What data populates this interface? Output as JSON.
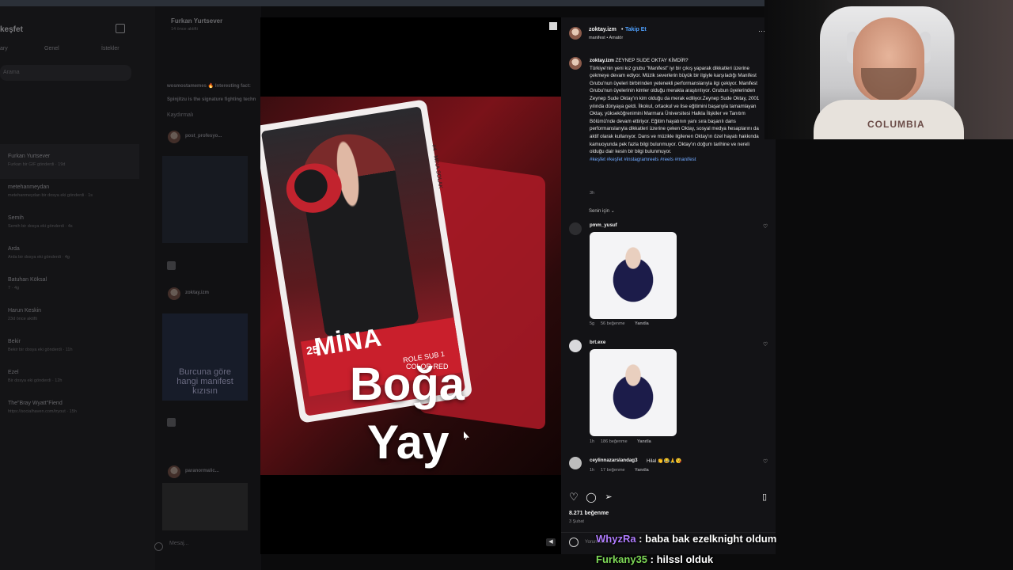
{
  "dm": {
    "title": "keşfet",
    "tabs": [
      "ary",
      "Genel",
      "İstekler"
    ],
    "search_placeholder": "Arama",
    "conversations": [
      {
        "name": "Furkan Yurtsever",
        "sub": "Furkan bir GIF gönderdi · 19d"
      },
      {
        "name": "metehanmeydan",
        "sub": "metehanmeydan bir dosya eki gönderdi · 1s"
      },
      {
        "name": "Semih",
        "sub": "Semih bir dosya eki gönderdi · 4s"
      },
      {
        "name": "Arda",
        "sub": "Arda bir dosya eki gönderdi · 4g"
      },
      {
        "name": "Batuhan Köksal",
        "sub": "7 · 4g"
      },
      {
        "name": "Harun Keskin",
        "sub": "23d önce aktifti"
      },
      {
        "name": "Bekir",
        "sub": "Bekir bir dosya eki gönderdi · 11h"
      },
      {
        "name": "Ezel",
        "sub": "Bir dosya eki gönderdi · 12h"
      },
      {
        "name": "The\"Bray Wyatt\"Fiend",
        "sub": "https://socialhaven.com/tryout · 15h"
      }
    ]
  },
  "chat_panel": {
    "name": "Furkan Yurtsever",
    "status": "14 önce aktifti",
    "snippets": [
      "wosmostamemes 🔥 Interesting fact:",
      "Spinjitzu is the signature fighting techn"
    ],
    "section": "Kaydırmalı",
    "shares": [
      {
        "user": "post_profesyo..."
      },
      {
        "user": "zoktay.izm",
        "caption": "Burcuna göre hangi manifest kızısın"
      },
      {
        "user": "paranormalic..."
      }
    ],
    "input_placeholder": "Mesaj..."
  },
  "post": {
    "overlay_line1": "Boğa",
    "overlay_line2": "Yay",
    "card_name": "MİNA",
    "card_number": "25",
    "card_role": "ROLE SUB 1",
    "card_color": "COLOR RED",
    "card_side": "#4 · MİNA SOLAK"
  },
  "panel": {
    "username": "zoktay.izm",
    "follow": "Takip Et",
    "subline": "manifest • Amatör",
    "caption_title": "ZEYNEP SUDE OKTAY KİMDİR?",
    "caption_body": "Türkiye'nin yeni kız grubu \"Manifest\" iyi bir çıkış yaparak dikkatleri üzerine çekmeye devam ediyor. Müzik severlerin büyük bir ilgiyle karşıladığı Manifest Grubu'nun üyeleri birbirinden yetenekli performanslarıyla ilgi çekiyor. Manifest Grubu'nun üyelerinin kimler olduğu merakla araştırılıyor. Grubun üyelerinden Zeynep Sude Oktay'ın kim olduğu da merak ediliyor.Zeynep Sude Oktay, 2001 yılında dünyaya geldi. İlkokul, ortaokul ve lise eğitimini başarıyla tamamlayan Oktay, yükseköğrenimini Marmara Üniversitesi Halkla İlişkiler ve Tanıtım Bölümü'nde devam ettiriyor. Eğitim hayatının yanı sıra başarılı dans performanslarıyla dikkatleri üzerine çeken Oktay, sosyal medya hesaplarını da aktif olarak kullanıyor. Dans ve müzikle ilgilenen Oktay'ın özel hayatı hakkında kamuoyunda pek fazla bilgi bulunmuyor. Oktay'ın doğum tarihine ve nereli olduğu dair kesin bir bilgi bulunmuyor.",
    "hashtags": "#keşfet #keşfet #instagramreels #reels #manifest",
    "caption_time": "3h",
    "sort_label": "Senin için",
    "comments": [
      {
        "user": "pmm_yusuf",
        "text": "",
        "time": "5g",
        "likes": "56 beğenme",
        "reply": "Yanıtla"
      },
      {
        "user": "brt.exe",
        "text": "",
        "time": "1h",
        "likes": "186 beğenme",
        "reply": "Yanıtla"
      },
      {
        "user": "ceylinnazarslandag3",
        "text": "Hilal 👏😂🙏😘",
        "time": "1h",
        "likes": "17 beğenme",
        "reply": "Yanıtla"
      }
    ],
    "likes": "8.271 beğenme",
    "date": "3 Şubat",
    "comment_placeholder": "Yorum ekle..."
  },
  "webcam": {
    "shirt_text": "COLUMBIA"
  },
  "stream_chat": [
    {
      "user": "WhyzRa",
      "message": "baba bak ezelknight oldum"
    },
    {
      "user": "Furkany35",
      "message": "hilssl olduk"
    }
  ],
  "colors": {
    "accent": "#4ea0ff",
    "chat_user1": "#b07cff",
    "chat_user2": "#7ed957",
    "card_red": "#c91f2c"
  }
}
